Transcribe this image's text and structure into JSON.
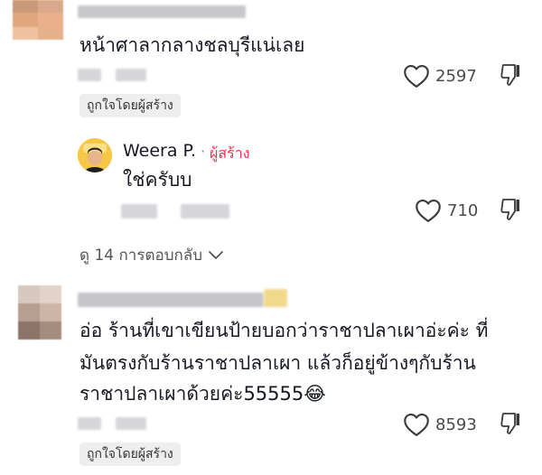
{
  "comments": [
    {
      "text_lines": [
        "หน้าศาลากลางชลบุรีแน่เลย"
      ],
      "likes": "2597",
      "creator_badge": "ถูกใจโดยผู้สร้าง"
    },
    {
      "text_lines": [
        "อ่อ ร้านที่เขาเขียนป้ายบอกว่าราชาปลาเผาอ่ะค่ะ ที่",
        "มันตรงกับร้านราชาปลาเผา แล้วก็อยู่ข้างๆกับร้าน",
        "ราชาปลาเผาด้วยค่ะ55555"
      ],
      "emoji": "😂",
      "likes": "8593",
      "creator_badge": "ถูกใจโดยผู้สร้าง"
    }
  ],
  "reply": {
    "author": "Weera P.",
    "separator": "·",
    "creator_tag": "ผู้สร้าง",
    "text": "ใช่ครับบ",
    "likes": "710"
  },
  "view_replies": {
    "label": "ดู 14 การตอบกลับ"
  },
  "icons": {
    "like": "heart-outline-icon",
    "dislike": "thumbs-down-icon",
    "expand": "chevron-down-icon"
  },
  "colors": {
    "creator_tag": "#fe2c55",
    "badge_bg": "#eeeeee"
  }
}
